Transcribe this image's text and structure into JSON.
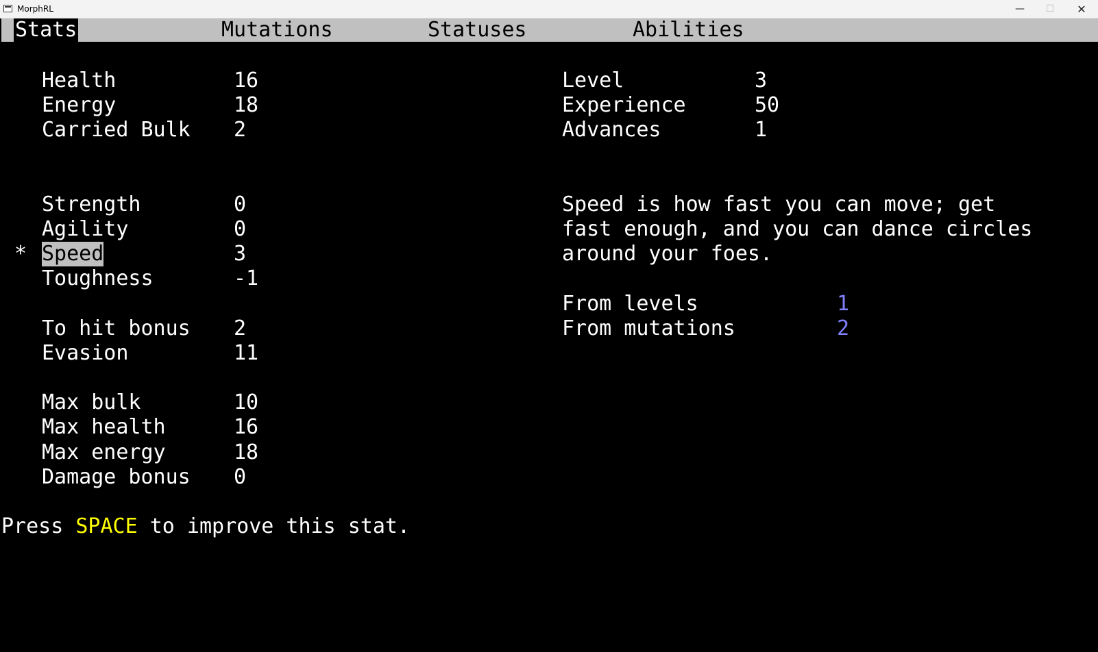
{
  "window": {
    "title": "MorphRL",
    "minimize": "—",
    "maximize": "☐",
    "close": "✕",
    "app_icon": "terminal-icon"
  },
  "tabs": [
    "Stats",
    "Mutations",
    "Statuses",
    "Abilities"
  ],
  "active_tab": 0,
  "stats_top": [
    {
      "label": "Health",
      "value": "16"
    },
    {
      "label": "Energy",
      "value": "18"
    },
    {
      "label": "Carried Bulk",
      "value": "2"
    }
  ],
  "stats_core": [
    {
      "label": "Strength",
      "value": "0"
    },
    {
      "label": "Agility",
      "value": "0"
    },
    {
      "label": "Speed",
      "value": "3"
    },
    {
      "label": "Toughness",
      "value": "-1"
    }
  ],
  "selected_marker": "*",
  "stats_combat": [
    {
      "label": "To hit bonus",
      "value": "2"
    },
    {
      "label": "Evasion",
      "value": "11"
    }
  ],
  "stats_max": [
    {
      "label": "Max bulk",
      "value": "10"
    },
    {
      "label": "Max health",
      "value": "16"
    },
    {
      "label": "Max energy",
      "value": "18"
    },
    {
      "label": "Damage bonus",
      "value": "0"
    }
  ],
  "progress": [
    {
      "label": "Level",
      "value": "3"
    },
    {
      "label": "Experience",
      "value": "50"
    },
    {
      "label": "Advances",
      "value": "1"
    }
  ],
  "description": [
    "Speed is how fast you can move; get",
    "fast enough, and you can dance circles",
    "around your foes."
  ],
  "breakdown": [
    {
      "label": "From levels",
      "value": "1"
    },
    {
      "label": "From mutations",
      "value": "2"
    }
  ],
  "prompt": {
    "before": "Press ",
    "key": "SPACE",
    "after": " to improve this stat."
  },
  "colors": {
    "highlight": "#c0c0c0",
    "breakdown_value": "#8080ff",
    "key": "#ffff00"
  }
}
